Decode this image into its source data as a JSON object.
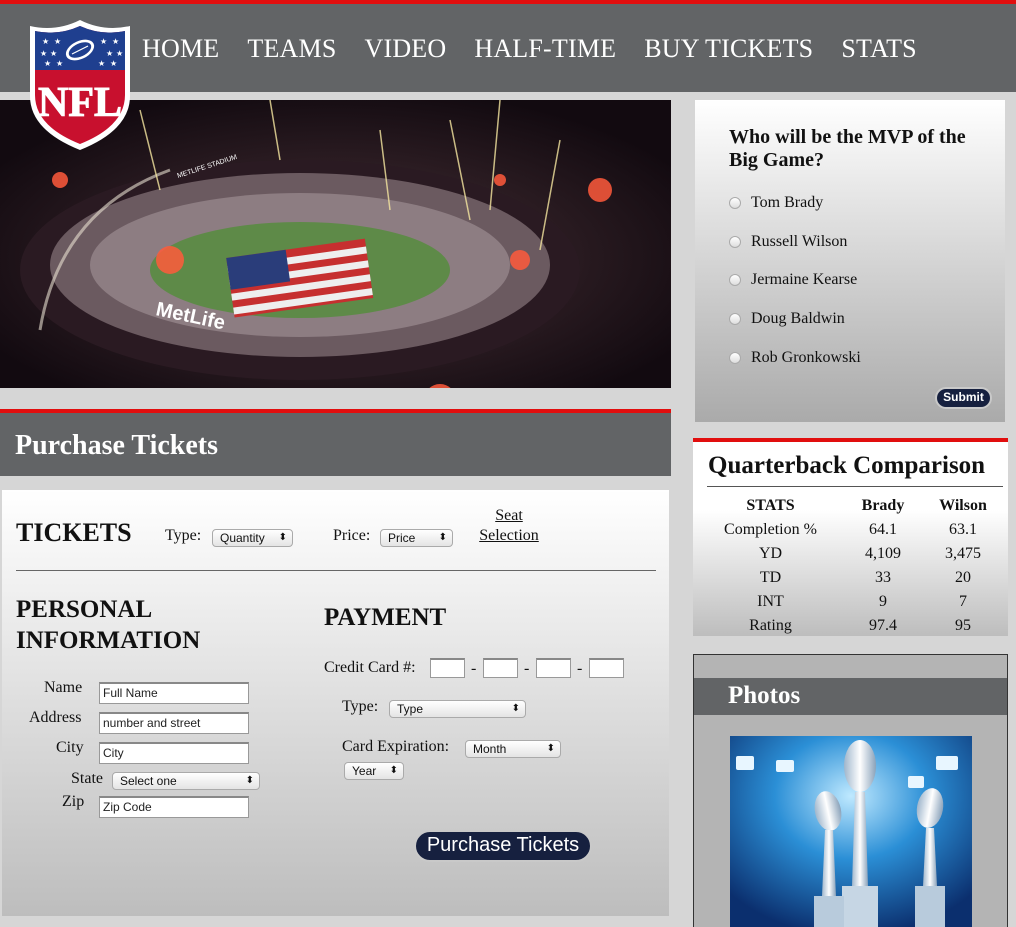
{
  "nav": {
    "logo_text": "NFL",
    "links": [
      "HOME",
      "TEAMS",
      "VIDEO",
      "HALF-TIME",
      "BUY TICKETS",
      "STATS"
    ]
  },
  "hero": {
    "stadium_sign": "MetLife",
    "stadium_name": "METLIFE STADIUM"
  },
  "poll": {
    "question": "Who will be the MVP of the Big Game?",
    "options": [
      "Tom Brady",
      "Russell Wilson",
      "Jermaine Kearse",
      "Doug Baldwin",
      "Rob Gronkowski"
    ],
    "submit_label": "Submit"
  },
  "purchase": {
    "title": "Purchase Tickets",
    "tickets_heading": "TICKETS",
    "type_label": "Type:",
    "type_value": "Quantity",
    "price_label": "Price:",
    "price_value": "Price",
    "seat_selection_line1": "Seat",
    "seat_selection_line2": "Selection",
    "personal_heading_line1": "PERSONAL",
    "personal_heading_line2": "INFORMATION",
    "name_label": "Name",
    "name_placeholder": "Full Name",
    "address_label": "Address",
    "address_placeholder": "number and street",
    "city_label": "City",
    "city_placeholder": "City",
    "state_label": "State",
    "state_value": "Select one",
    "zip_label": "Zip",
    "zip_placeholder": "Zip Code",
    "payment_heading": "PAYMENT",
    "cc_label": "Credit Card #:",
    "cc_separator": "-",
    "card_type_label": "Type:",
    "card_type_value": "Type",
    "expiration_label": "Card Expiration:",
    "month_value": "Month",
    "year_value": "Year",
    "purchase_button": "Purchase Tickets"
  },
  "qb": {
    "title": "Quarterback Comparison",
    "headers": [
      "STATS",
      "Brady",
      "Wilson"
    ],
    "rows": [
      [
        "Completion %",
        "64.1",
        "63.1"
      ],
      [
        "YD",
        "4,109",
        "3,475"
      ],
      [
        "TD",
        "33",
        "20"
      ],
      [
        "INT",
        "9",
        "7"
      ],
      [
        "Rating",
        "97.4",
        "95"
      ]
    ]
  },
  "photos": {
    "title": "Photos"
  },
  "colors": {
    "accent_red": "#e10e0e",
    "nav_gray": "#626466",
    "button_navy": "#16203f"
  }
}
